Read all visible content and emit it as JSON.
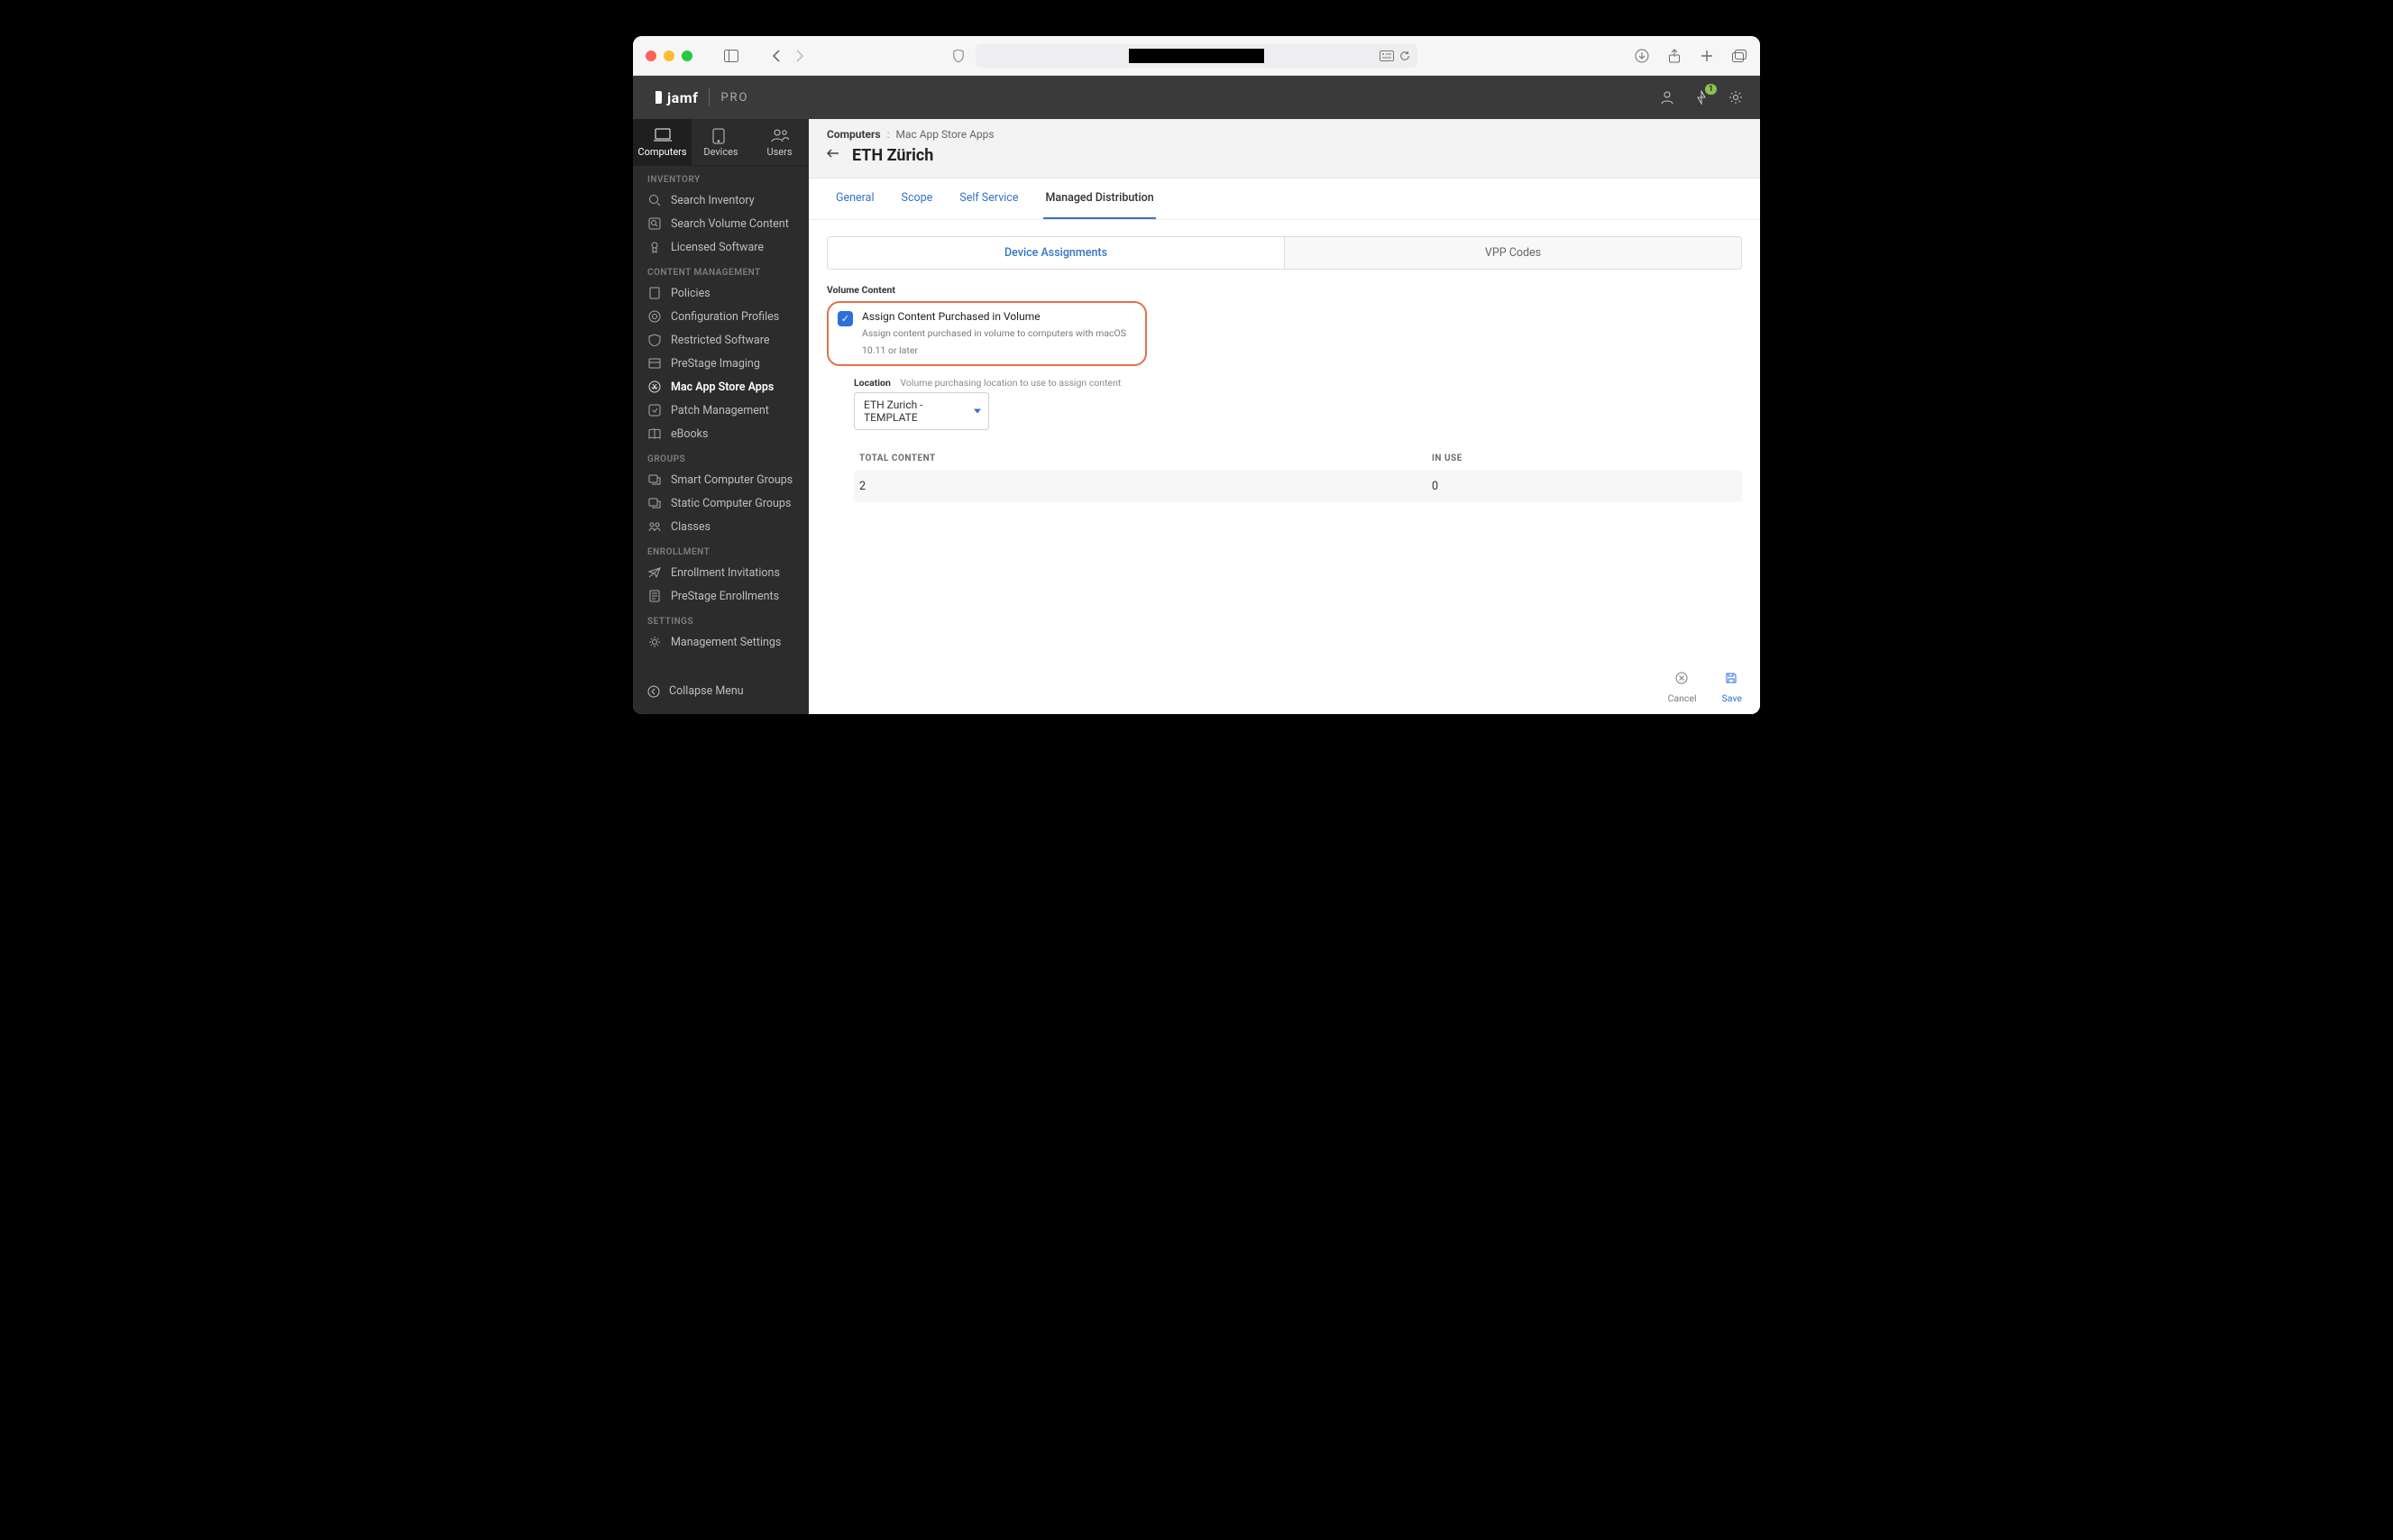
{
  "header": {
    "brand": "jamf",
    "brand_sub": "PRO",
    "notification_badge": "1"
  },
  "toptabs": [
    {
      "label": "Computers",
      "active": true
    },
    {
      "label": "Devices",
      "active": false
    },
    {
      "label": "Users",
      "active": false
    }
  ],
  "sidebar": {
    "sections": {
      "inventory": "INVENTORY",
      "content_management": "CONTENT MANAGEMENT",
      "groups": "GROUPS",
      "enrollment": "ENROLLMENT",
      "settings": "SETTINGS"
    },
    "items": {
      "search_inventory": "Search Inventory",
      "search_volume_content": "Search Volume Content",
      "licensed_software": "Licensed Software",
      "policies": "Policies",
      "configuration_profiles": "Configuration Profiles",
      "restricted_software": "Restricted Software",
      "prestage_imaging": "PreStage Imaging",
      "mac_app_store_apps": "Mac App Store Apps",
      "patch_management": "Patch Management",
      "ebooks": "eBooks",
      "smart_computer_groups": "Smart Computer Groups",
      "static_computer_groups": "Static Computer Groups",
      "classes": "Classes",
      "enrollment_invitations": "Enrollment Invitations",
      "prestage_enrollments": "PreStage Enrollments",
      "management_settings": "Management Settings"
    },
    "collapse": "Collapse Menu"
  },
  "breadcrumbs": {
    "root": "Computers",
    "sep": ":",
    "leaf": "Mac App Store Apps"
  },
  "page_title": "ETH Zürich",
  "tabs": [
    {
      "label": "General"
    },
    {
      "label": "Scope"
    },
    {
      "label": "Self Service"
    },
    {
      "label": "Managed Distribution"
    }
  ],
  "subtabs": {
    "device_assignments": "Device Assignments",
    "vpp_codes": "VPP Codes"
  },
  "volume_content": {
    "section_label": "Volume Content",
    "checkbox_title": "Assign Content Purchased in Volume",
    "checkbox_desc": "Assign content purchased in volume to computers with macOS 10.11 or later",
    "checked": true,
    "location_label": "Location",
    "location_hint": "Volume purchasing location to use to assign content",
    "location_value": "ETH Zurich - TEMPLATE"
  },
  "table": {
    "headers": {
      "total_content": "TOTAL CONTENT",
      "in_use": "IN USE"
    },
    "row": {
      "total_content": "2",
      "in_use": "0"
    }
  },
  "footer": {
    "cancel": "Cancel",
    "save": "Save"
  }
}
